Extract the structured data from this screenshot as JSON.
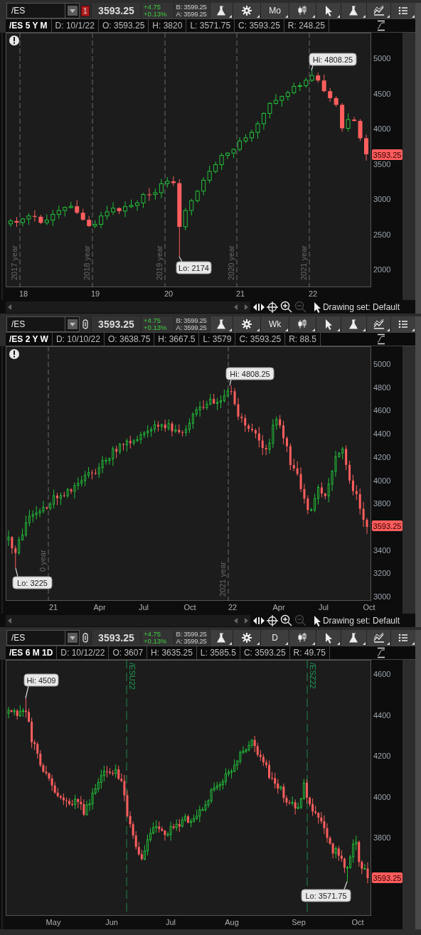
{
  "panels": [
    {
      "toolbar": {
        "symbol": "/ES",
        "indicator": {
          "kind": "badge",
          "text": "1"
        },
        "price": "3593.25",
        "change": "+4.75",
        "change_percent": "+0.13%",
        "bid": "B: 3599.25",
        "ask": "A: 3599.25",
        "period": "Mo"
      },
      "info": [
        "/ES 5 Y M",
        "D: 10/1/22",
        "O: 3593.25",
        "H: 3820",
        "L: 3571.75",
        "C: 3593.25",
        "R: 248.25"
      ],
      "chart": {
        "alert": true,
        "y_labels": [
          "5000",
          "4500",
          "4000",
          "3500",
          "3000",
          "2500",
          "2000"
        ],
        "x_labels": [
          "18",
          "19",
          "20",
          "21",
          "22"
        ],
        "markers": [
          {
            "kind": "year",
            "label": "2017 year"
          },
          {
            "kind": "year",
            "label": "2018 year"
          },
          {
            "kind": "year",
            "label": "2019 year"
          },
          {
            "kind": "year",
            "label": "2020 year"
          },
          {
            "kind": "year",
            "label": "2021 year"
          }
        ],
        "high": "Hi: 4808.25",
        "low": "Lo: 2174",
        "last_price": "3593.25"
      },
      "footer": {
        "label": "Drawing set: Default",
        "zoom_out_disabled": true
      }
    },
    {
      "toolbar": {
        "symbol": "/ES",
        "indicator": {
          "kind": "link"
        },
        "price": "3593.25",
        "change": "+4.75",
        "change_percent": "+0.13%",
        "bid": "B: 3599.25",
        "ask": "A: 3599.25",
        "period": "Wk"
      },
      "info": [
        "/ES 2 Y W",
        "D: 10/10/22",
        "O: 3638.75",
        "H: 3667.5",
        "L: 3579",
        "C: 3593.25",
        "R: 88.5"
      ],
      "chart": {
        "alert": true,
        "y_labels": [
          "5000",
          "4800",
          "4600",
          "4400",
          "4200",
          "4000",
          "3800",
          "3400",
          "3200",
          "3000"
        ],
        "x_labels": [
          "21",
          "Apr",
          "Jul",
          "Oct",
          "22",
          "Apr",
          "Jul",
          "Oct"
        ],
        "markers": [
          {
            "kind": "year",
            "label": "0 year"
          },
          {
            "kind": "year",
            "label": "2021 year"
          }
        ],
        "high": "Hi: 4808.25",
        "low": "Lo: 3225",
        "last_price": "3593.25"
      },
      "footer": {
        "label": "Drawing set: Default",
        "zoom_out_disabled": true
      }
    },
    {
      "toolbar": {
        "symbol": "/ES",
        "indicator": {
          "kind": "link"
        },
        "price": "3593.25",
        "change": "+4.75",
        "change_percent": "+0.13%",
        "bid": "B: 3599.25",
        "ask": "A: 3599.25",
        "period": "D"
      },
      "info": [
        "/ES 6 M 1D",
        "D: 10/12/22",
        "O: 3607",
        "H: 3635.25",
        "L: 3585.5",
        "C: 3593.25",
        "R: 49.75"
      ],
      "chart": {
        "alert": false,
        "y_labels": [
          "4600",
          "4400",
          "4200",
          "4000",
          "3800"
        ],
        "x_labels": [
          "May",
          "Jun",
          "Jul",
          "Aug",
          "Sep",
          "Oct"
        ],
        "markers": [
          {
            "kind": "expiration",
            "label": "/ESU22"
          },
          {
            "kind": "expiration",
            "label": "/ESZ22"
          }
        ],
        "high": "Hi: 4509",
        "low": "Lo: 3571.75",
        "last_price": "3593.25"
      }
    }
  ]
}
